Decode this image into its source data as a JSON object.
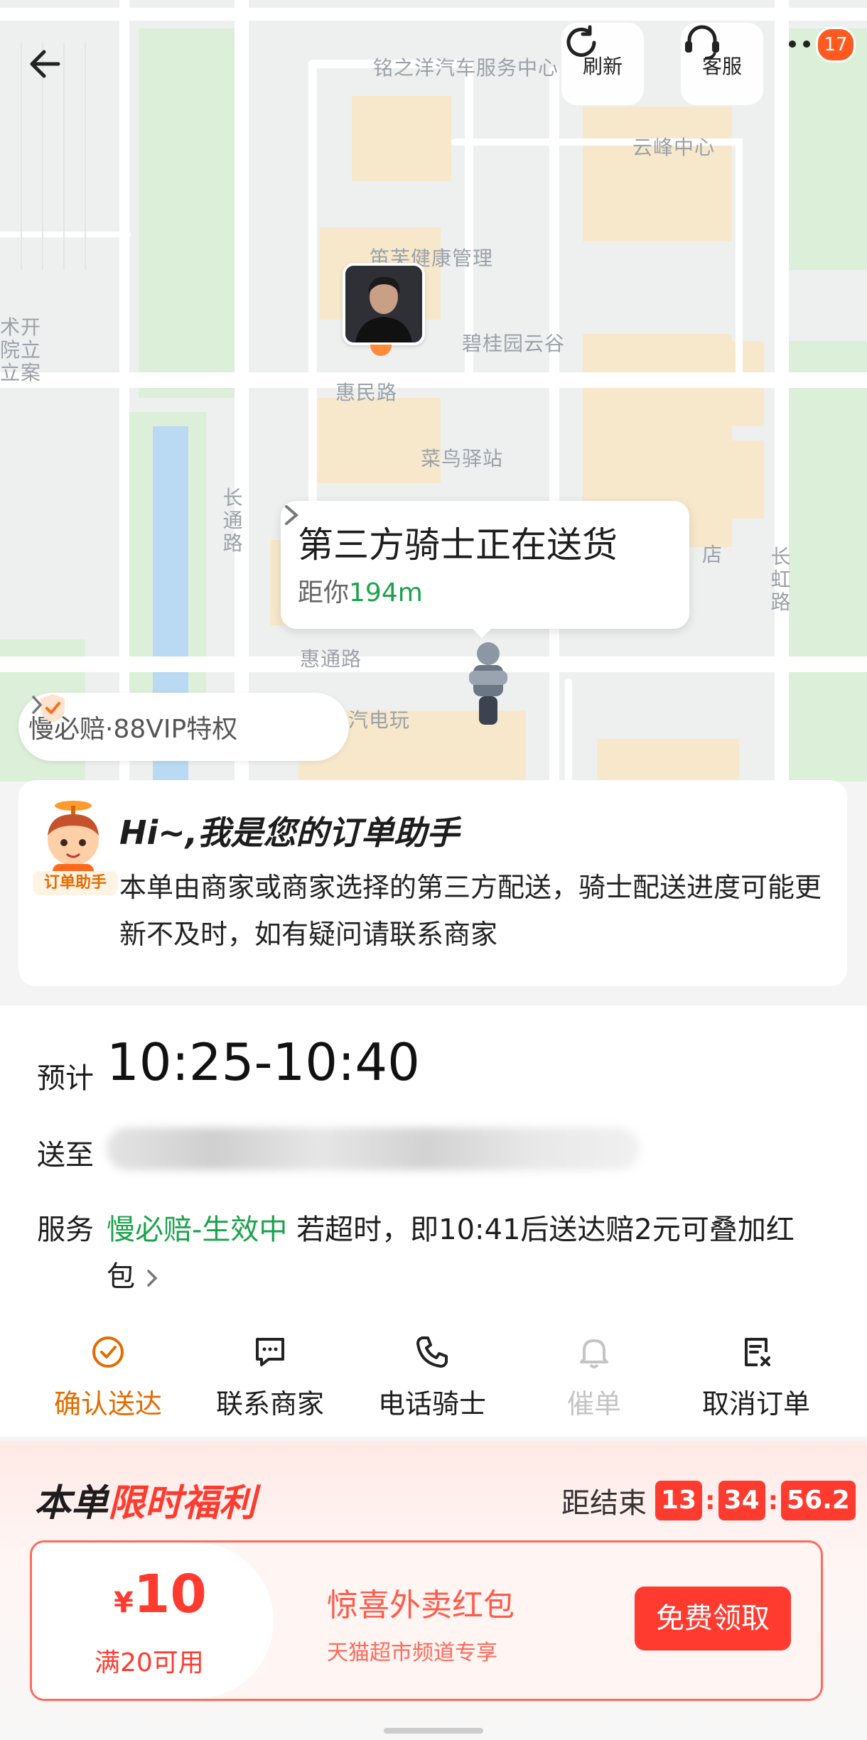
{
  "map": {
    "labels": {
      "service_center": "铭之洋汽车服务中心",
      "yunfeng": "云峰中心",
      "health_mgmt": "笛芙健康管理",
      "biguiyuan": "碧桂园云谷",
      "huimin_road": "惠民路",
      "cainiao": "菜鸟驿站",
      "changtong_road": "长通路",
      "huitong_road": "惠通路",
      "changhong_road": "长虹路",
      "car_elec": "汽电玩",
      "shop": "店",
      "left_edge": "术开院立立案"
    },
    "refresh_label": "刷新",
    "service_label": "客服",
    "badge_count": "17",
    "status_title": "第三方骑士正在送货",
    "distance_prefix": "距你",
    "distance_value": "194m",
    "vip_text": "慢必赔·88VIP特权"
  },
  "assistant": {
    "tag": "订单助手",
    "title": "Hi~,我是您的订单助手",
    "body": "本单由商家或商家选择的第三方配送，骑士配送进度可能更新不及时，如有疑问请联系商家"
  },
  "order": {
    "eta_label": "预计",
    "eta_time": "10:25-10:40",
    "addr_label": "送至",
    "service_label": "服务",
    "service_status": "慢必赔-生效中",
    "service_desc": " 若超时，即10:41后送达赔2元可叠加红包",
    "actions": [
      {
        "label": "确认送达",
        "icon": "check-circle-icon",
        "state": "active"
      },
      {
        "label": "联系商家",
        "icon": "chat-icon",
        "state": "normal"
      },
      {
        "label": "电话骑士",
        "icon": "phone-icon",
        "state": "normal"
      },
      {
        "label": "催单",
        "icon": "bell-icon",
        "state": "disabled"
      },
      {
        "label": "取消订单",
        "icon": "cancel-doc-icon",
        "state": "normal"
      }
    ]
  },
  "promo": {
    "title_black": "本单",
    "title_red": "限时福利",
    "countdown_label": "距结束",
    "countdown": [
      "13",
      "34",
      "56.2"
    ],
    "currency": "¥",
    "amount": "10",
    "condition": "满20可用",
    "coupon_title": "惊喜外卖红包",
    "coupon_sub": "天猫超市频道专享",
    "claim_label": "免费领取"
  },
  "colors": {
    "accent_orange": "#e36b00",
    "green": "#1aa34a",
    "red": "#ff3b30"
  }
}
